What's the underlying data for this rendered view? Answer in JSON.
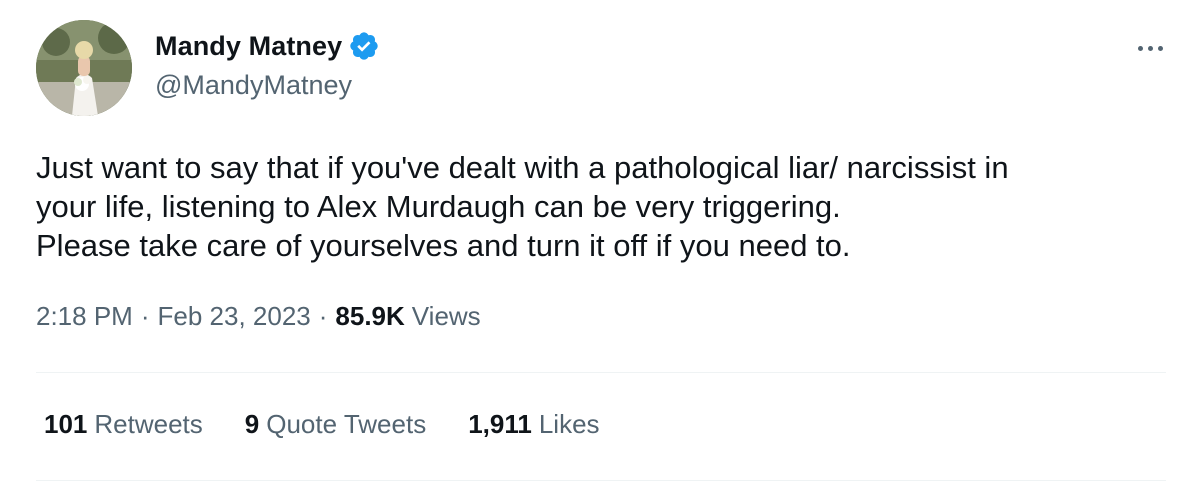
{
  "author": {
    "display_name": "Mandy Matney",
    "handle": "@MandyMatney",
    "verified_badge_icon": "verified-check-icon",
    "badge_color": "#1d9bf0"
  },
  "menu": {
    "more_icon": "more-horizontal-icon"
  },
  "tweet": {
    "text": "Just want to say that if you've dealt with a pathological liar/ narcissist in\nyour life, listening to Alex Murdaugh can be very triggering.\nPlease take care of yourselves and turn it off if you need to."
  },
  "meta": {
    "time": "2:18 PM",
    "separator": "·",
    "date": "Feb 23, 2023",
    "views_count": "85.9K",
    "views_label": "Views"
  },
  "stats": {
    "retweets_count": "101",
    "retweets_label": "Retweets",
    "quotes_count": "9",
    "quotes_label": "Quote Tweets",
    "likes_count": "1,911",
    "likes_label": "Likes"
  }
}
